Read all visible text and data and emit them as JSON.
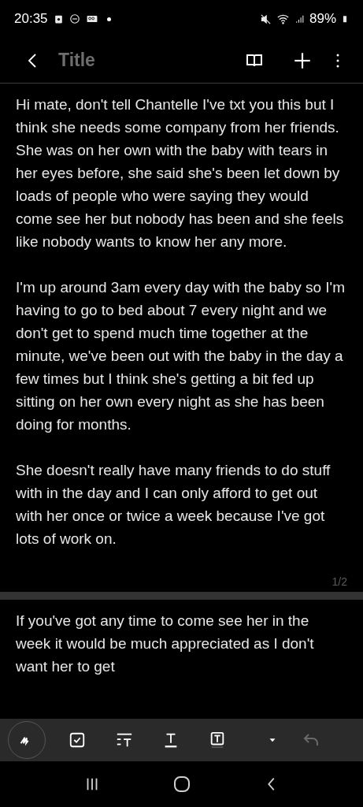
{
  "status_bar": {
    "time": "20:35",
    "battery": "89%"
  },
  "header": {
    "title_placeholder": "Title"
  },
  "pages": [
    {
      "paragraphs": [
        "Hi mate, don't tell Chantelle I've txt you this but I think she needs some company from her friends. She was on her own with the baby with tears in her eyes before, she said she's been let down by loads of people who were saying they would come see her but nobody has been and she feels like nobody wants to know her any more.",
        "I'm up around 3am every day with the baby so I'm having to go to bed about 7 every night and we don't get to spend much time together at the minute, we've been out with the baby in the day a few times but I think she's getting a bit fed up sitting on her own every night as she has been doing for months.",
        "She doesn't really have many friends to do stuff with in the day and I can only afford to get out with her once or twice a week because I've got lots of work on."
      ],
      "page_number": "1/2"
    },
    {
      "paragraphs": [
        "If you've got any time to come see her in the week it would be much appreciated as I don't want her to get"
      ]
    }
  ],
  "toolbar": {
    "undo_disabled": true
  }
}
